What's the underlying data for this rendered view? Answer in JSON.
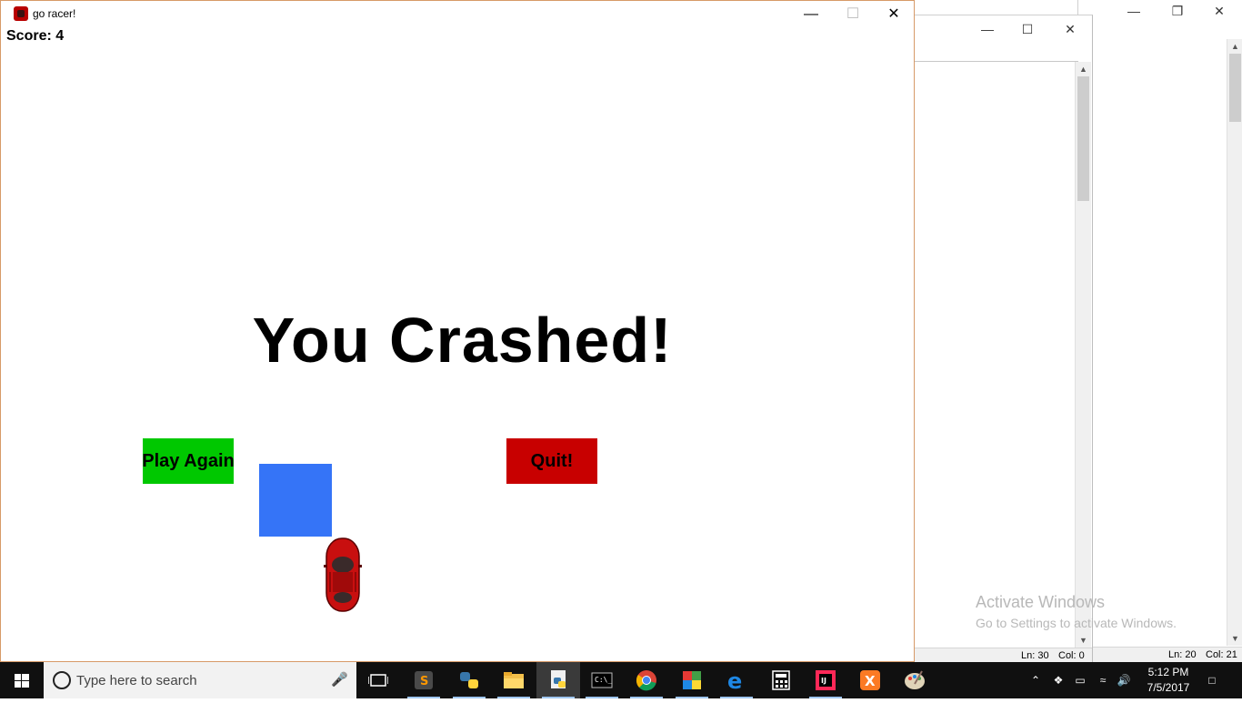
{
  "game_window": {
    "title": "go racer!",
    "score_text": "Score: 4",
    "message": "You Crashed!",
    "play_again_label": "Play Again",
    "quit_label": "Quit!",
    "colors": {
      "play_again": "#00c800",
      "quit": "#c80000",
      "obstacle": "#3574f7",
      "car": "#c80000"
    }
  },
  "background_windows": [
    {
      "status_line": "Ln: 30",
      "status_col": "Col: 0"
    },
    {
      "status_line": "Ln: 20",
      "status_col": "Col: 21"
    }
  ],
  "watermark": {
    "line1": "Activate Windows",
    "line2": "Go to Settings to activate Windows."
  },
  "taskbar": {
    "search_placeholder": "Type here to search",
    "apps": [
      "task-view",
      "sublime-text",
      "python-idle",
      "file-explorer",
      "python-file",
      "command-prompt",
      "chrome",
      "minecraft",
      "edge",
      "calculator",
      "intellij",
      "xampp",
      "paint"
    ],
    "clock_time": "5:12 PM",
    "clock_date": "7/5/2017"
  }
}
